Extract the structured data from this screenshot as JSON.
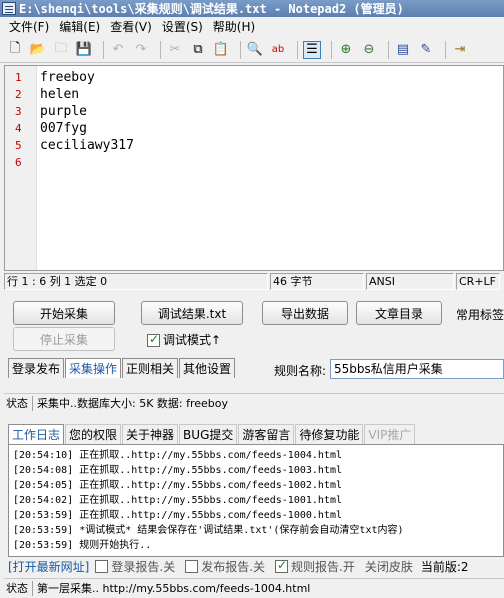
{
  "window": {
    "title": "E:\\shenqi\\tools\\采集规则\\调试结果.txt - Notepad2 (管理员)"
  },
  "menu": {
    "items": [
      "文件(F)",
      "编辑(E)",
      "查看(V)",
      "设置(S)",
      "帮助(H)"
    ]
  },
  "editor": {
    "line_numbers": [
      "1",
      "2",
      "3",
      "4",
      "5",
      "6"
    ],
    "lines": [
      "freeboy",
      "helen",
      "purple",
      "007fyg",
      "ceciliawy317",
      ""
    ]
  },
  "statusbar": {
    "position": "行 1 : 6   列 1   选定 0",
    "bytes": "46 字节",
    "encoding": "ANSI",
    "eol": "CR+LF"
  },
  "collector": {
    "start_button": "开始采集",
    "stop_button": "停止采集",
    "debug_result_button": "调试结果.txt",
    "debug_mode_label": "调试模式↑",
    "debug_mode_checked": true,
    "export_button": "导出数据",
    "article_dir_button": "文章目录",
    "common_tags_label": "常用标签",
    "tabs": [
      "登录发布",
      "采集操作",
      "正则相关",
      "其他设置"
    ],
    "selected_tab": 1,
    "rule_name_label": "规则名称:",
    "rule_name_value": "55bbs私信用户采集",
    "status_label": "状态",
    "status_text": "采集中..数据库大小: 5K 数据: freeboy"
  },
  "log": {
    "tabs": [
      "工作日志",
      "您的权限",
      "关于神器",
      "BUG提交",
      "游客留言",
      "待修复功能",
      "VIP推广"
    ],
    "selected_tab": 0,
    "lines": [
      "[20:54:10] 正在抓取..http://my.55bbs.com/feeds-1004.html",
      "[20:54:08] 正在抓取..http://my.55bbs.com/feeds-1003.html",
      "[20:54:05] 正在抓取..http://my.55bbs.com/feeds-1002.html",
      "[20:54:02] 正在抓取..http://my.55bbs.com/feeds-1001.html",
      "[20:53:59] 正在抓取..http://my.55bbs.com/feeds-1000.html",
      "[20:53:59] *调试模式* 结果会保存在'调试结果.txt'(保存前会自动清空txt内容)",
      "[20:53:59] 规则开始执行.."
    ]
  },
  "options": {
    "open_latest_link": "[打开最新网址]",
    "login_report": "登录报告.关",
    "publish_report": "发布报告.关",
    "rule_report": "规则报告.开",
    "rule_report_checked": true,
    "close_skin": "关闭皮肤",
    "current_version_label": "当前版:2"
  },
  "bottom_status": {
    "label": "状态",
    "text": "第一层采集.. http://my.55bbs.com/feeds-1004.html"
  }
}
